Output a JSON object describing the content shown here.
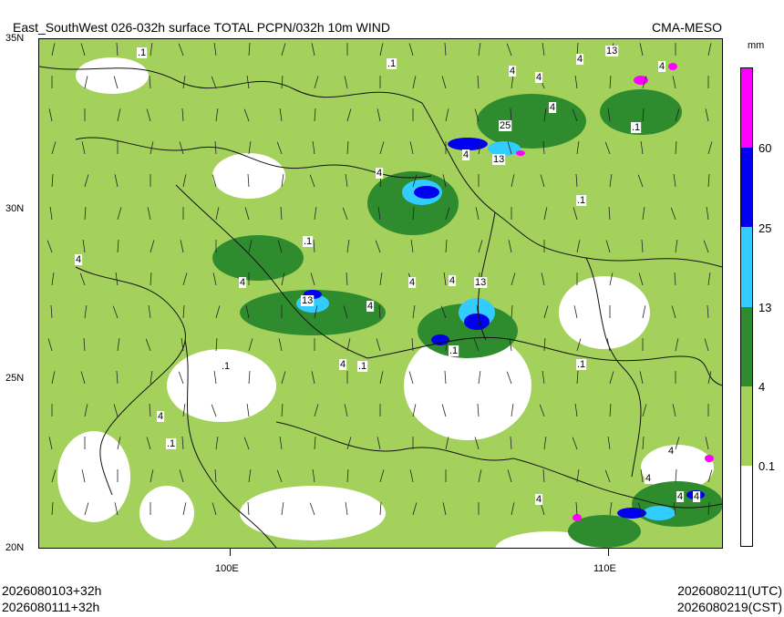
{
  "header": {
    "title": "East_SouthWest 026-032h surface TOTAL PCPN/032h 10m WIND",
    "model": "CMA-MESO"
  },
  "axes": {
    "lat_labels": [
      "35N",
      "30N",
      "25N",
      "20N"
    ],
    "lon_labels": [
      "100E",
      "110E"
    ]
  },
  "colorbar": {
    "unit": "mm",
    "levels": [
      "0.1",
      "4",
      "13",
      "25",
      "60"
    ],
    "colors": [
      "#ffffff",
      "#a4d15c",
      "#2e8b2e",
      "#33ccff",
      "#0000ee",
      "#ff00ff"
    ]
  },
  "map_labels": [
    ".1",
    "4",
    "13",
    "25"
  ],
  "footer": {
    "left_line1": "2026080103+32h",
    "left_line2": "2026080111+32h",
    "right_line1": "2026080211(UTC)",
    "right_line2": "2026080219(CST)"
  }
}
